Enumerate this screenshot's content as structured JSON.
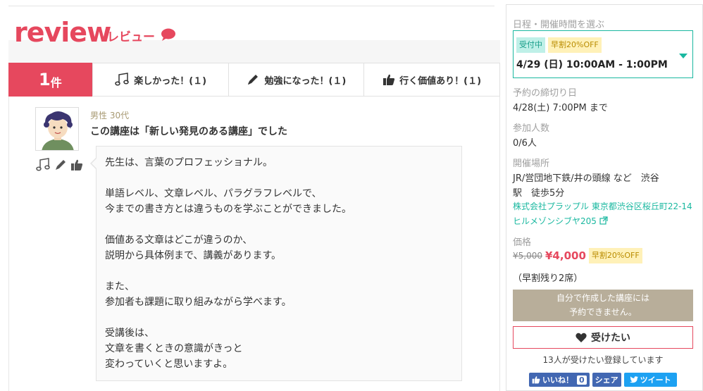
{
  "header": {
    "title": "review",
    "subtitle": "レビュー"
  },
  "tabs": {
    "count_num": "1",
    "count_unit": "件",
    "items": [
      {
        "label": "楽しかった！(１)",
        "icon": "music-note-icon"
      },
      {
        "label": "勉強になった！(１)",
        "icon": "pen-icon"
      },
      {
        "label": "行く価値あり！(１)",
        "icon": "thumbs-up-icon"
      }
    ]
  },
  "review": {
    "meta": "男性 30代",
    "title": "この講座は「新しい発見のある講座」でした",
    "body": [
      "先生は、言葉のプロフェッショナル。",
      "単語レベル、文章レベル、パラグラフレベルで、\n今までの書き方とは違うものを学ぶことができました。",
      "価値ある文章はどこが違うのか、\n説明から具体例まで、講義があります。",
      "また、\n参加者も課題に取り組みながら学べます。",
      "受講後は、\n文章を書くときの意識がきっと\n変わっていくと思いますよ。"
    ]
  },
  "sidebar": {
    "schedule_label": "日程・開催時間を選ぶ",
    "badge_open": "受付中",
    "badge_early": "早割20%OFF",
    "selected_date": "4/29 (日) 10:00AM - 1:00PM",
    "deadline_label": "予約の締切り日",
    "deadline_value": "4/28(土) 7:00PM まで",
    "participants_label": "参加人数",
    "participants_value": "0/6人",
    "venue_label": "開催場所",
    "venue_line1": "JR/営団地下鉄/井の頭線 など　渋谷",
    "venue_line2": "駅　徒歩5分",
    "venue_link": "株式会社プラップル 東京都渋谷区桜丘町22-14 ヒルメゾンシブヤ205",
    "price_label": "価格",
    "price_old": "¥5,000",
    "price_new": "¥4,000",
    "price_badge": "早割20%OFF",
    "early_remaining": "（早割残り2席）",
    "disabled_line1": "自分で作成した講座には",
    "disabled_line2": "予約できません。",
    "want_label": "受けたい",
    "want_count": "13人が受けたい登録しています",
    "fb_like": "いいね！",
    "fb_count": "0",
    "fb_share": "シェア",
    "tweet": "ツイート"
  },
  "colors": {
    "accent": "#e6485e",
    "teal": "#1ab8a0",
    "disabled": "#b8ae9a",
    "facebook": "#4267b2",
    "twitter": "#1da1f2"
  }
}
